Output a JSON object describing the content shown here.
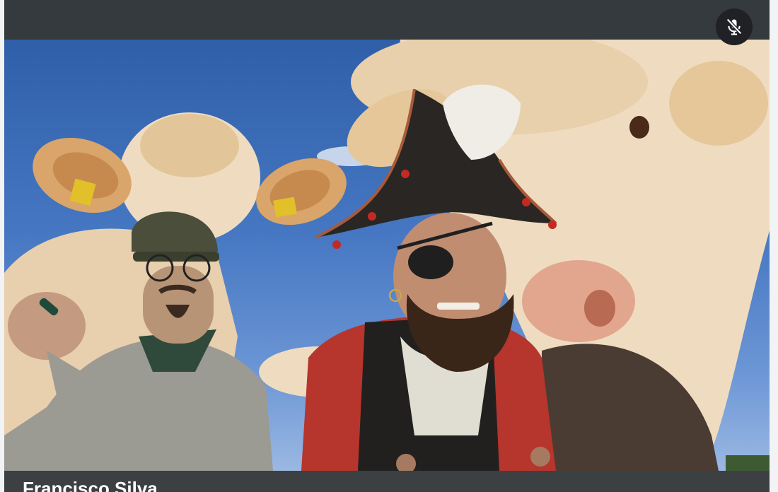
{
  "participant": {
    "name": "Francisco Silva",
    "muted": true
  },
  "icons": {
    "mic_status": "mic-off-icon"
  },
  "colors": {
    "tile_background": "#3c4043",
    "top_bar": "#353a3e",
    "mic_badge": "#202124",
    "name_text": "#ffffff"
  }
}
